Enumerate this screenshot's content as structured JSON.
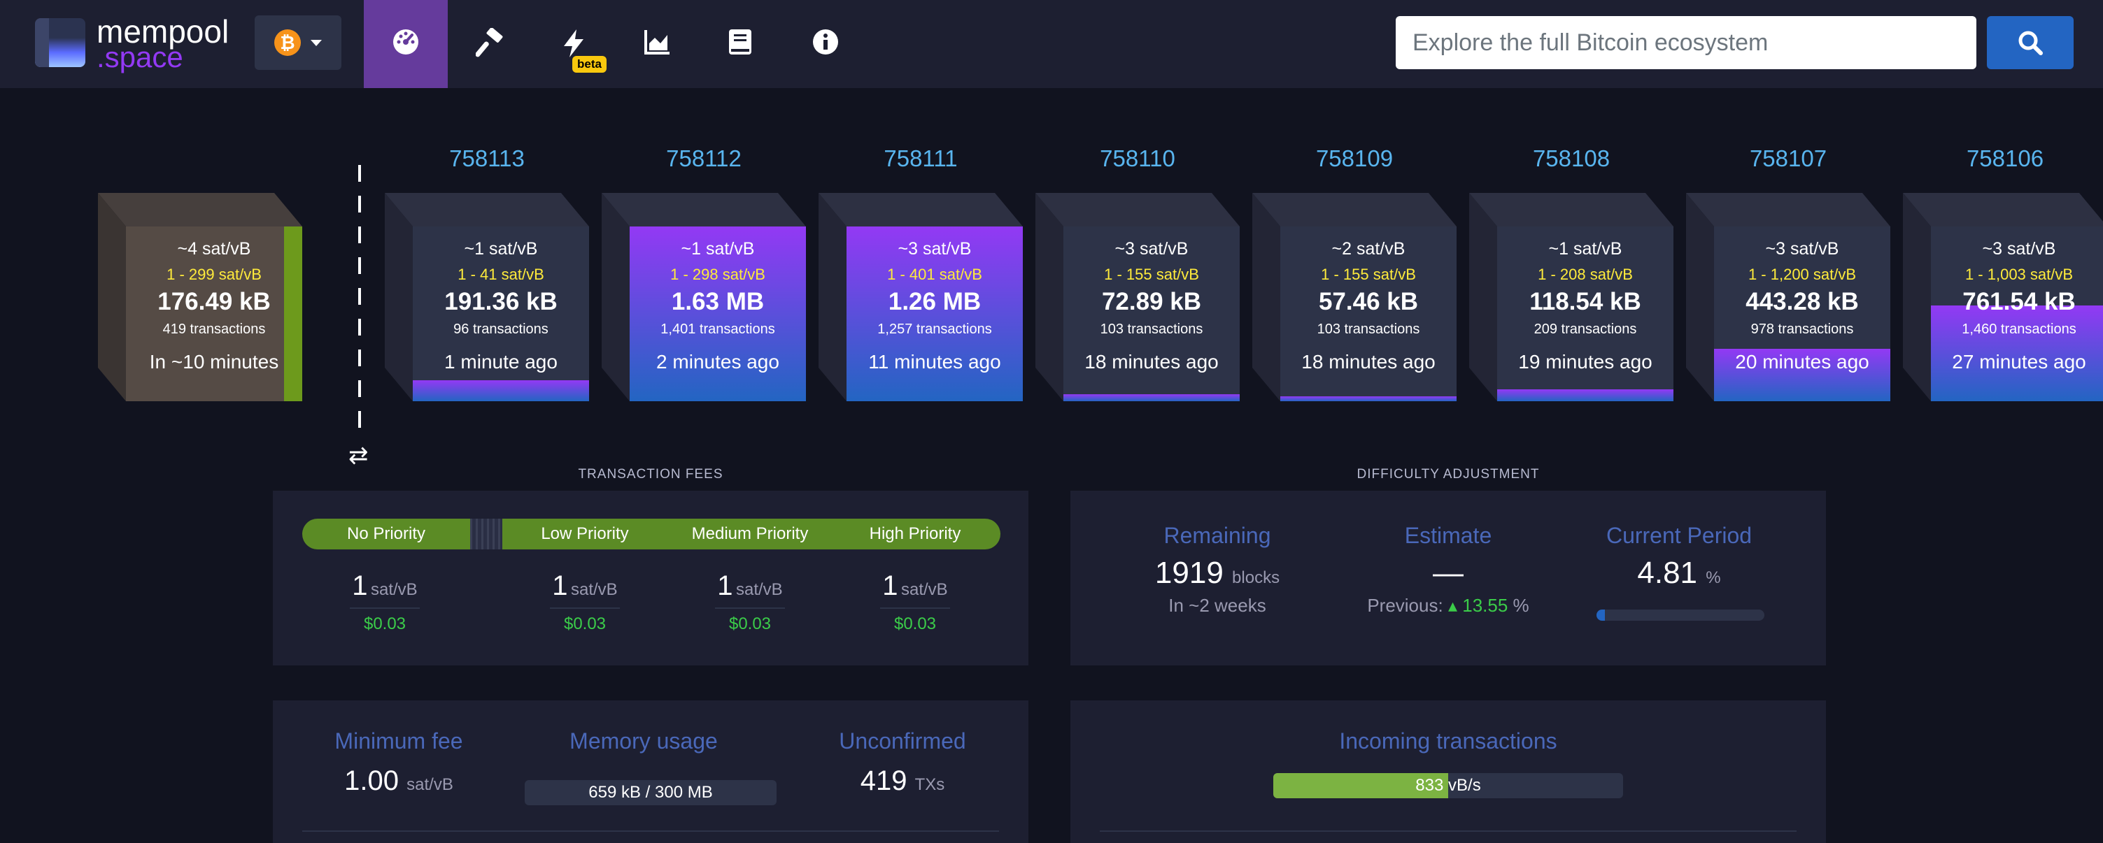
{
  "navbar": {
    "logo_text_1": "mempool",
    "logo_text_2": ".space",
    "network_icon": "bitcoin-icon",
    "items": [
      {
        "name": "dashboard",
        "icon": "gauge-icon"
      },
      {
        "name": "mining",
        "icon": "hammer-icon"
      },
      {
        "name": "lightning",
        "icon": "bolt-icon",
        "badge": "beta"
      },
      {
        "name": "graphs",
        "icon": "area-chart-icon"
      },
      {
        "name": "docs",
        "icon": "book-icon"
      },
      {
        "name": "about",
        "icon": "info-icon"
      }
    ],
    "search_placeholder": "Explore the full Bitcoin ecosystem",
    "search_icon": "search-icon"
  },
  "mempool_block": {
    "median": "~4 sat/vB",
    "range": "1 - 299 sat/vB",
    "size": "176.49 kB",
    "tx_count": "419 transactions",
    "eta": "In ~10 minutes"
  },
  "blocks": [
    {
      "height": "758113",
      "median": "~1 sat/vB",
      "range": "1 - 41 sat/vB",
      "size": "191.36 kB",
      "tx_count": "96 transactions",
      "time": "1 minute ago",
      "fill": 0.12
    },
    {
      "height": "758112",
      "median": "~1 sat/vB",
      "range": "1 - 298 sat/vB",
      "size": "1.63 MB",
      "tx_count": "1,401 transactions",
      "time": "2 minutes ago",
      "fill": 1.0
    },
    {
      "height": "758111",
      "median": "~3 sat/vB",
      "range": "1 - 401 sat/vB",
      "size": "1.26 MB",
      "tx_count": "1,257 transactions",
      "time": "11 minutes ago",
      "fill": 1.0
    },
    {
      "height": "758110",
      "median": "~3 sat/vB",
      "range": "1 - 155 sat/vB",
      "size": "72.89 kB",
      "tx_count": "103 transactions",
      "time": "18 minutes ago",
      "fill": 0.04
    },
    {
      "height": "758109",
      "median": "~2 sat/vB",
      "range": "1 - 155 sat/vB",
      "size": "57.46 kB",
      "tx_count": "103 transactions",
      "time": "18 minutes ago",
      "fill": 0.03
    },
    {
      "height": "758108",
      "median": "~1 sat/vB",
      "range": "1 - 208 sat/vB",
      "size": "118.54 kB",
      "tx_count": "209 transactions",
      "time": "19 minutes ago",
      "fill": 0.07
    },
    {
      "height": "758107",
      "median": "~3 sat/vB",
      "range": "1 - 1,200 sat/vB",
      "size": "443.28 kB",
      "tx_count": "978 transactions",
      "time": "20 minutes ago",
      "fill": 0.3
    },
    {
      "height": "758106",
      "median": "~3 sat/vB",
      "range": "1 - 1,003 sat/vB",
      "size": "761.54 kB",
      "tx_count": "1,460 transactions",
      "time": "27 minutes ago",
      "fill": 0.55
    }
  ],
  "transaction_fees": {
    "title": "TRANSACTION FEES",
    "labels": [
      "No Priority",
      "Low Priority",
      "Medium Priority",
      "High Priority"
    ],
    "values": [
      "1",
      "1",
      "1",
      "1"
    ],
    "unit": "sat/vB",
    "usd": [
      "$0.03",
      "$0.03",
      "$0.03",
      "$0.03"
    ]
  },
  "difficulty": {
    "title": "DIFFICULTY ADJUSTMENT",
    "remaining_label": "Remaining",
    "remaining_value": "1919",
    "remaining_unit": "blocks",
    "remaining_sub": "In ~2 weeks",
    "estimate_label": "Estimate",
    "estimate_value": "—",
    "previous_label": "Previous:",
    "previous_value": "13.55",
    "previous_unit": "%",
    "period_label": "Current Period",
    "period_value": "4.81",
    "period_unit": "%",
    "period_progress": 0.0481
  },
  "mempool_stats": {
    "min_fee_label": "Minimum fee",
    "min_fee_value": "1.00",
    "min_fee_unit": "sat/vB",
    "memory_label": "Memory usage",
    "memory_value": "659 kB / 300 MB",
    "unconfirmed_label": "Unconfirmed",
    "unconfirmed_value": "419",
    "unconfirmed_unit": "TXs"
  },
  "incoming": {
    "label": "Incoming transactions",
    "value": "833",
    "unit": "vB/s",
    "fill": 0.5
  },
  "colors": {
    "navbar": "#1d1f31",
    "background": "#11131f",
    "active_nav": "#653b9c",
    "accent_blue": "#2365c2",
    "block_height": "#59b5ef",
    "fee_range": "#ffeb3b",
    "priority_green": "#5b8b25",
    "usd_green": "#3bcc49"
  }
}
